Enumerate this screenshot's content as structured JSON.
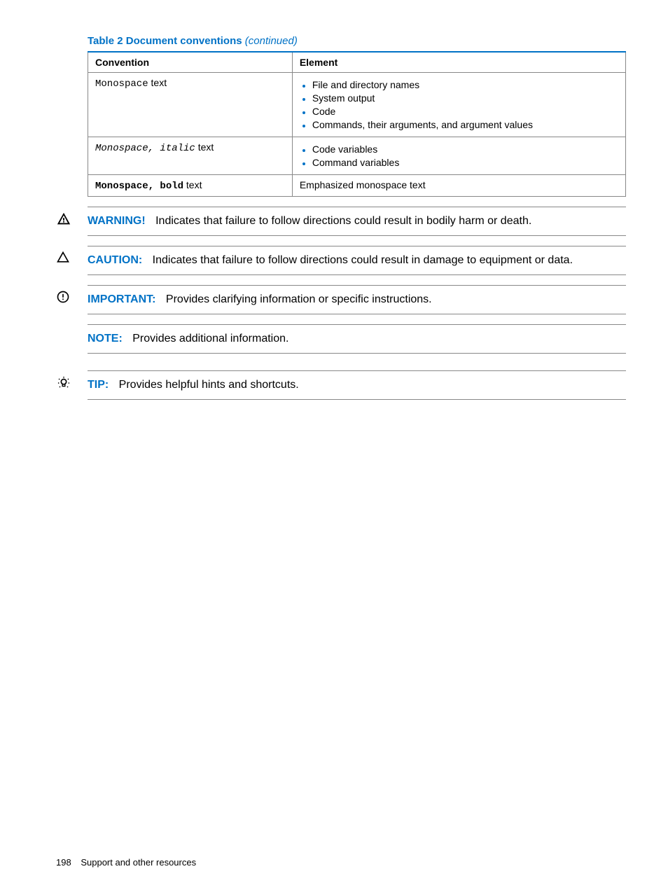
{
  "table": {
    "caption_bold": "Table 2 Document conventions",
    "caption_italic": "(continued)",
    "headers": {
      "c1": "Convention",
      "c2": "Element"
    },
    "rows": [
      {
        "conv_mono": "Monospace",
        "conv_plain": " text",
        "elements": [
          "File and directory names",
          "System output",
          "Code",
          "Commands, their arguments, and argument values"
        ]
      },
      {
        "conv_mono_italic": "Monospace, italic",
        "conv_plain": " text",
        "elements": [
          "Code variables",
          "Command variables"
        ]
      },
      {
        "conv_mono_bold": "Monospace, bold",
        "conv_plain": " text",
        "element_text": "Emphasized monospace text"
      }
    ]
  },
  "callouts": {
    "warning": {
      "label": "WARNING!",
      "text": "Indicates that failure to follow directions could result in bodily harm or death."
    },
    "caution": {
      "label": "CAUTION:",
      "text": "Indicates that failure to follow directions could result in damage to equipment or data."
    },
    "important": {
      "label": "IMPORTANT:",
      "text": "Provides clarifying information or specific instructions."
    },
    "note": {
      "label": "NOTE:",
      "text": "Provides additional information."
    },
    "tip": {
      "label": "TIP:",
      "text": "Provides helpful hints and shortcuts."
    }
  },
  "footer": {
    "page": "198",
    "section": "Support and other resources"
  }
}
